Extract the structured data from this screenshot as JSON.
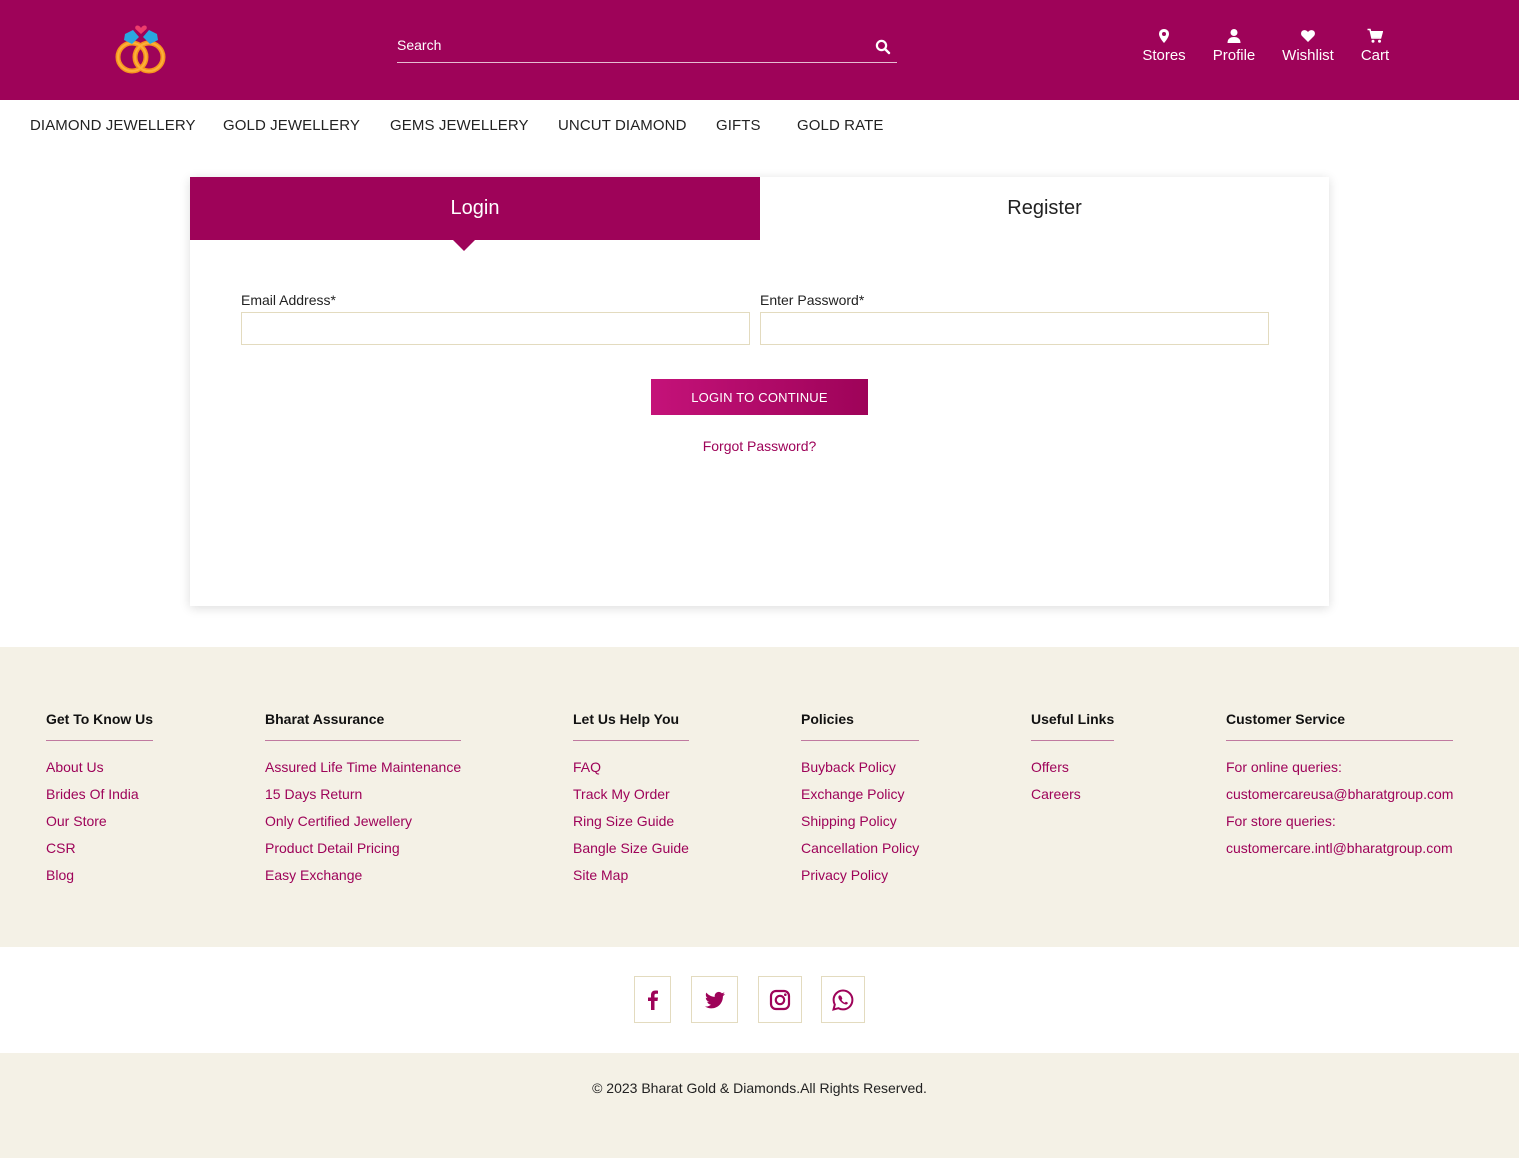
{
  "header": {
    "search": {
      "placeholder": "Search"
    },
    "items": {
      "stores": "Stores",
      "profile": "Profile",
      "wishlist": "Wishlist",
      "cart": "Cart"
    },
    "brand_color": "#9e0359"
  },
  "nav": {
    "items": [
      "DIAMOND JEWELLERY",
      "GOLD JEWELLERY",
      "GEMS JEWELLERY",
      "UNCUT DIAMOND",
      "GIFTS",
      "GOLD RATE"
    ]
  },
  "auth": {
    "tabs": {
      "login": "Login",
      "register": "Register"
    },
    "active_tab": "login",
    "email_label": "Email Address*",
    "password_label": "Enter Password*",
    "email_value": "",
    "password_value": "",
    "submit_label": "LOGIN TO CONTINUE",
    "forgot_label": "Forgot Password?"
  },
  "footer": {
    "columns": [
      {
        "heading": "Get To Know Us",
        "links": [
          "About Us",
          "Brides Of India",
          "Our Store",
          "CSR",
          "Blog"
        ]
      },
      {
        "heading": "Bharat Assurance",
        "links": [
          "Assured Life Time Maintenance",
          "15 Days Return",
          "Only Certified Jewellery",
          "Product Detail Pricing",
          "Easy Exchange"
        ]
      },
      {
        "heading": "Let Us Help You",
        "links": [
          "FAQ",
          "Track My Order",
          "Ring Size Guide",
          "Bangle Size Guide",
          "Site Map"
        ]
      },
      {
        "heading": "Policies",
        "links": [
          "Buyback Policy",
          "Exchange Policy",
          "Shipping Policy",
          "Cancellation Policy",
          "Privacy Policy"
        ]
      },
      {
        "heading": "Useful Links",
        "links": [
          "Offers",
          "Careers"
        ]
      },
      {
        "heading": "Customer Service",
        "links": [
          "For online queries:",
          "customercareusa@bharatgroup.com",
          "For store queries:",
          "customercare.intl@bharatgroup.com"
        ]
      }
    ],
    "background": "#f4f1e6"
  },
  "social": {
    "icons": [
      "facebook-icon",
      "twitter-icon",
      "instagram-icon",
      "whatsapp-icon"
    ]
  },
  "copyright": "© 2023 Bharat Gold & Diamonds.All Rights Reserved."
}
